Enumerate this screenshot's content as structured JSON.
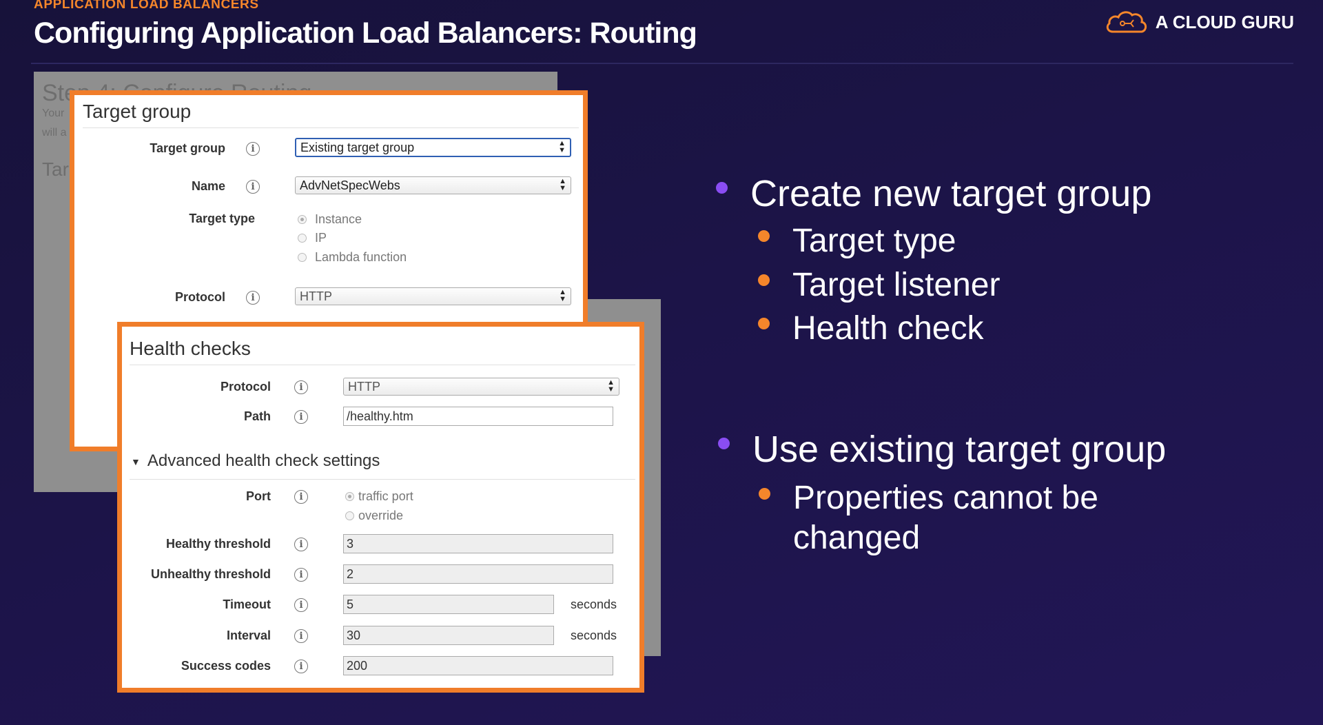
{
  "header": {
    "eyebrow": "APPLICATION LOAD BALANCERS",
    "title": "Configuring Application Load Balancers: Routing",
    "brand": "A CLOUD GURU"
  },
  "background_panel": {
    "step_title": "Step 4: Configure Routing",
    "line1": "Your",
    "line2": "will a",
    "section": "Tar"
  },
  "target_group": {
    "title": "Target group",
    "target_group_label": "Target group",
    "target_group_value": "Existing target group",
    "name_label": "Name",
    "name_value": "AdvNetSpecWebs",
    "target_type_label": "Target type",
    "target_type_options": [
      "Instance",
      "IP",
      "Lambda function"
    ],
    "protocol_label": "Protocol",
    "protocol_value": "HTTP"
  },
  "health_checks": {
    "title": "Health checks",
    "protocol_label": "Protocol",
    "protocol_value": "HTTP",
    "path_label": "Path",
    "path_value": "/healthy.htm",
    "advanced_label": "Advanced health check settings",
    "port_label": "Port",
    "port_options": [
      "traffic port",
      "override"
    ],
    "healthy_label": "Healthy threshold",
    "healthy_value": "3",
    "unhealthy_label": "Unhealthy threshold",
    "unhealthy_value": "2",
    "timeout_label": "Timeout",
    "timeout_value": "5",
    "interval_label": "Interval",
    "interval_value": "30",
    "seconds": "seconds",
    "success_label": "Success codes",
    "success_value": "200"
  },
  "info_glyph": "i",
  "bullets": {
    "create": "Create new target group",
    "create_items": [
      "Target type",
      "Target listener",
      "Health check"
    ],
    "existing": "Use existing target group",
    "existing_item_line1": "Properties cannot be",
    "existing_item_line2": "changed"
  },
  "colors": {
    "accent_orange": "#f5862b",
    "bullet_purple": "#8a4df3",
    "panel_border": "#f07d2a"
  }
}
